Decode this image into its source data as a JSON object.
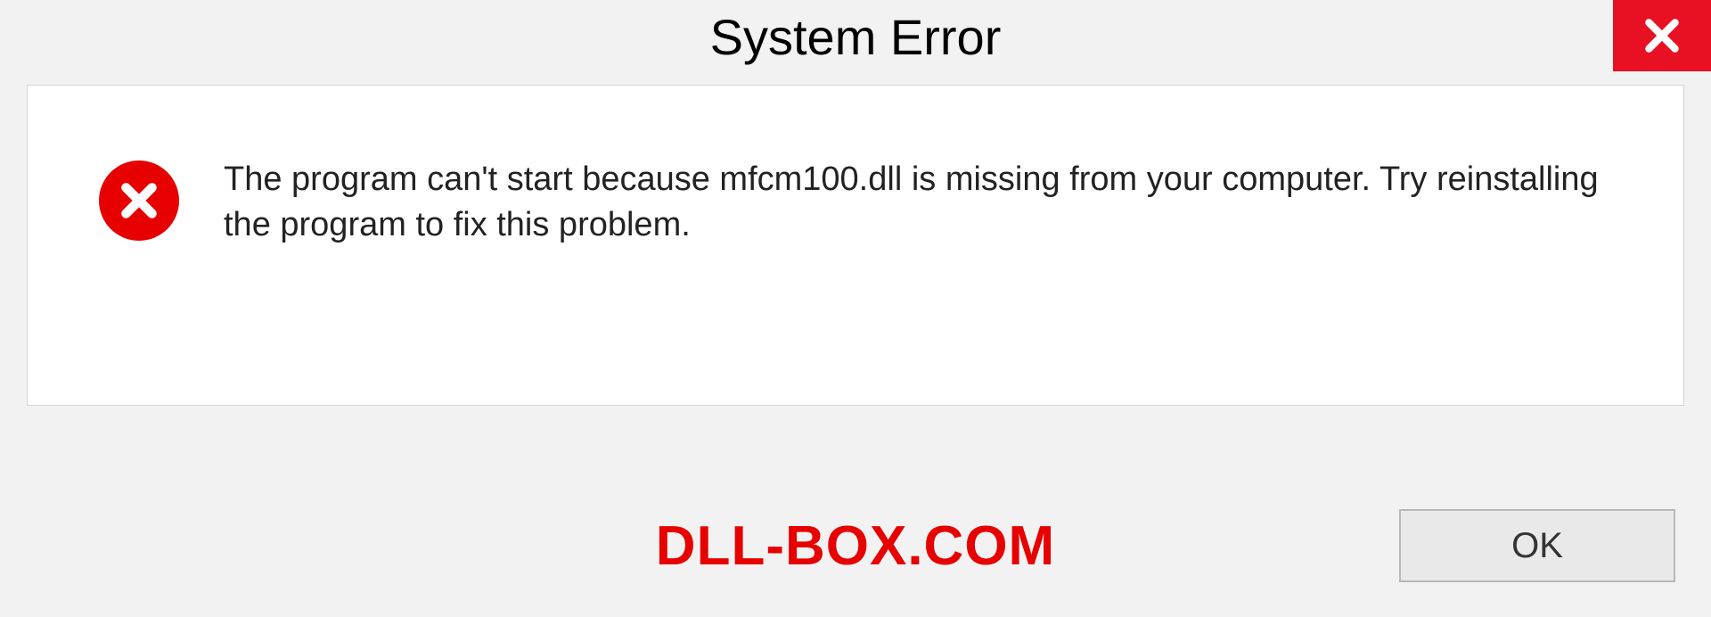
{
  "dialog": {
    "title": "System Error",
    "message": "The program can't start because mfcm100.dll is missing from your computer. Try reinstalling the program to fix this problem.",
    "ok_label": "OK"
  },
  "watermark": "DLL-BOX.COM",
  "icons": {
    "close": "close-icon",
    "error": "error-icon"
  },
  "colors": {
    "close_bg": "#e81123",
    "error_red": "#e60000",
    "panel_bg": "#ffffff",
    "page_bg": "#f2f2f2"
  }
}
